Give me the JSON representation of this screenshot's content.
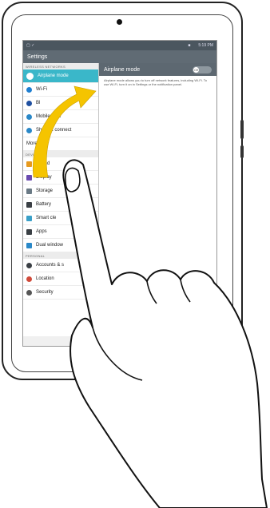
{
  "statusbar": {
    "time": "5:19 PM"
  },
  "header": {
    "title": "Settings"
  },
  "sections": {
    "wireless": "WIRELESS NETWORKS",
    "device": "DEVICE",
    "personal": "PERSONAL"
  },
  "menu": {
    "wireless": [
      {
        "label": "Airplane mode",
        "icon": "airplane-icon",
        "color": "#ffffff"
      },
      {
        "label": "Wi-Fi",
        "icon": "wifi-icon",
        "color": "#1f7fd1"
      },
      {
        "label": "Bl",
        "icon": "bluetooth-icon",
        "color": "#1f4fa0"
      },
      {
        "label": "Mobile data",
        "icon": "mobile-data-icon",
        "color": "#2a88c8"
      },
      {
        "label": "Share & connect",
        "icon": "share-connect-icon",
        "color": "#2a88c8"
      },
      {
        "label": "More...",
        "icon": "",
        "color": ""
      }
    ],
    "device": [
      {
        "label": "Sound",
        "icon": "sound-icon",
        "color": "#e79a1e"
      },
      {
        "label": "Display",
        "icon": "display-icon",
        "color": "#6a4bb0"
      },
      {
        "label": "Storage",
        "icon": "storage-icon",
        "color": "#6a7a85"
      },
      {
        "label": "Battery",
        "icon": "battery-icon",
        "color": "#3a3f44"
      },
      {
        "label": "Smart cle",
        "icon": "smart-cleaning-icon",
        "color": "#3aa0c8"
      },
      {
        "label": "Apps",
        "icon": "apps-icon",
        "color": "#3a3f44"
      },
      {
        "label": "Dual window",
        "icon": "dual-window-icon",
        "color": "#2a88c8"
      }
    ],
    "personal": [
      {
        "label": "Accounts & s",
        "icon": "accounts-icon",
        "color": "#3a3f44"
      },
      {
        "label": "Location",
        "icon": "location-icon",
        "color": "#d04a3a"
      },
      {
        "label": "Security",
        "icon": "security-icon",
        "color": "#555555"
      }
    ]
  },
  "detail": {
    "title": "Airplane mode",
    "toggle": "Off",
    "description": "Airplane mode allows you to turn off network features, including Wi-Fi. To use Wi-Fi, turn it on in Settings or the notification panel."
  },
  "colors": {
    "accent": "#3ab7c9",
    "arrow": "#f5c400",
    "header": "#5d6871"
  }
}
